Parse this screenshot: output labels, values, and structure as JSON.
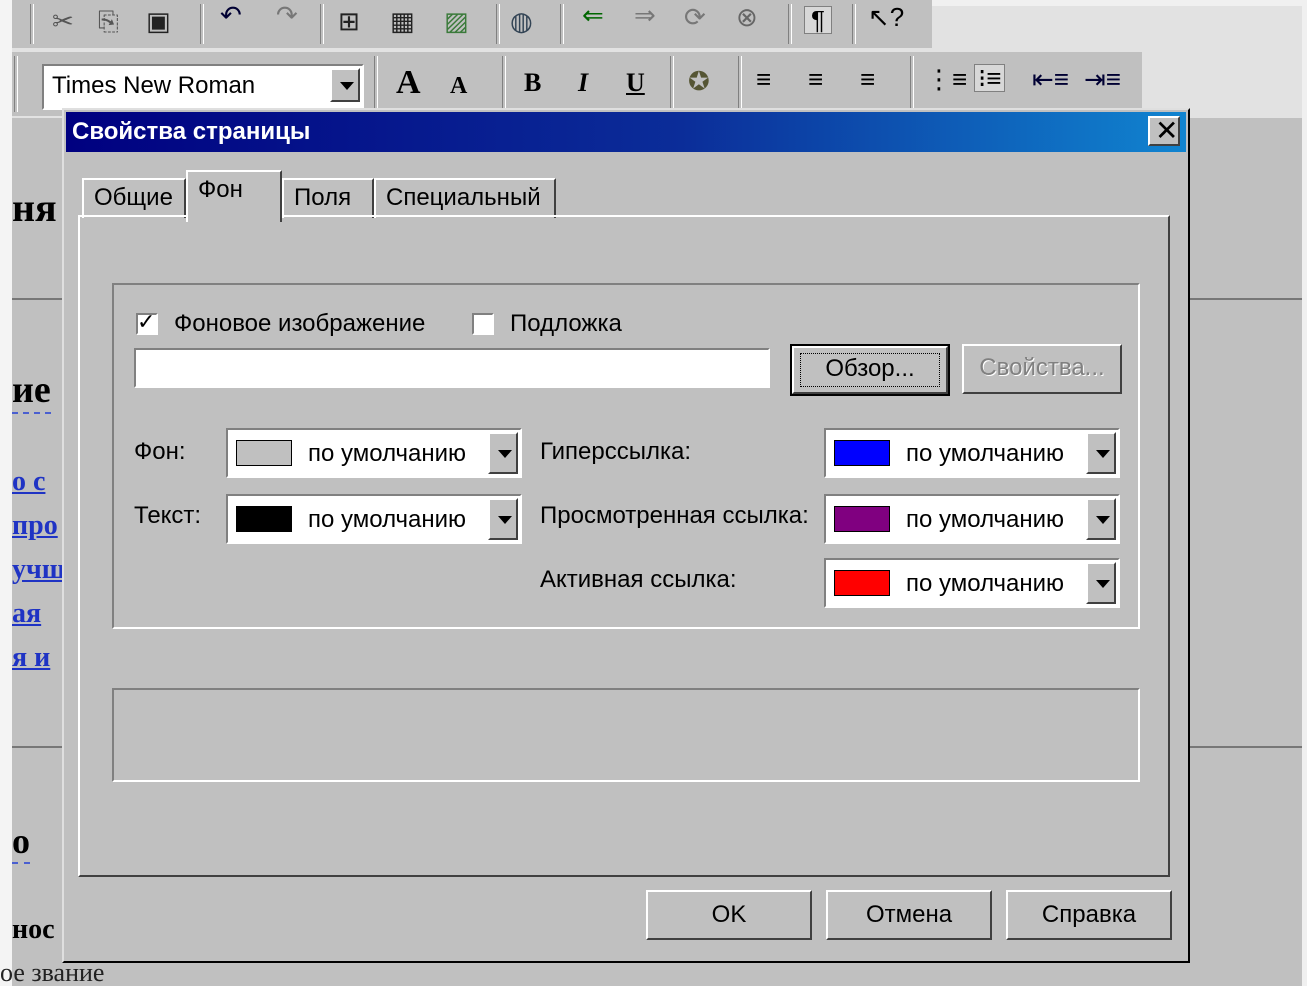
{
  "toolbar": {
    "font_name": "Times New Roman",
    "format_buttons": {
      "bold": "B",
      "italic": "I",
      "underline": "U"
    }
  },
  "background_doc": {
    "fragments": [
      "ня",
      "ие",
      "о",
      "нос"
    ],
    "links": [
      "о с",
      "про",
      "учш",
      "ая",
      "я и"
    ],
    "bottom_text": "ое звание"
  },
  "dialog": {
    "title": "Свойства страницы",
    "tabs": [
      "Общие",
      "Фон",
      "Поля",
      "Специальный"
    ],
    "background_image_label": "Фоновое изображение",
    "background_image_checked": true,
    "watermark_label": "Подложка",
    "watermark_checked": false,
    "image_path": "",
    "browse_button": "Обзор...",
    "properties_button": "Свойства...",
    "colors": {
      "background": {
        "label": "Фон:",
        "value": "по умолчанию",
        "swatch": "#c0c0c0"
      },
      "text": {
        "label": "Текст:",
        "value": "по умолчанию",
        "swatch": "#000000"
      },
      "hyperlink": {
        "label": "Гиперссылка:",
        "value": "по умолчанию",
        "swatch": "#0000ff"
      },
      "visited_link": {
        "label": "Просмотренная ссылка:",
        "value": "по умолчанию",
        "swatch": "#800080"
      },
      "active_link": {
        "label": "Активная ссылка:",
        "value": "по умолчанию",
        "swatch": "#ff0000"
      }
    },
    "ok_button": "OK",
    "cancel_button": "Отмена",
    "help_button": "Справка"
  },
  "icons": [
    "cut-icon",
    "copy-icon",
    "paste-icon",
    "undo-icon",
    "redo-icon",
    "table-icon",
    "grid-icon",
    "image-icon",
    "web-icon",
    "back-icon",
    "forward-icon",
    "refresh-icon",
    "stop-icon",
    "paragraph-icon",
    "help-pointer-icon",
    "grow-font-icon",
    "shrink-font-icon",
    "palette-icon",
    "align-left-icon",
    "align-center-icon",
    "align-right-icon",
    "numbered-list-icon",
    "bullet-list-icon",
    "outdent-icon",
    "indent-icon"
  ]
}
